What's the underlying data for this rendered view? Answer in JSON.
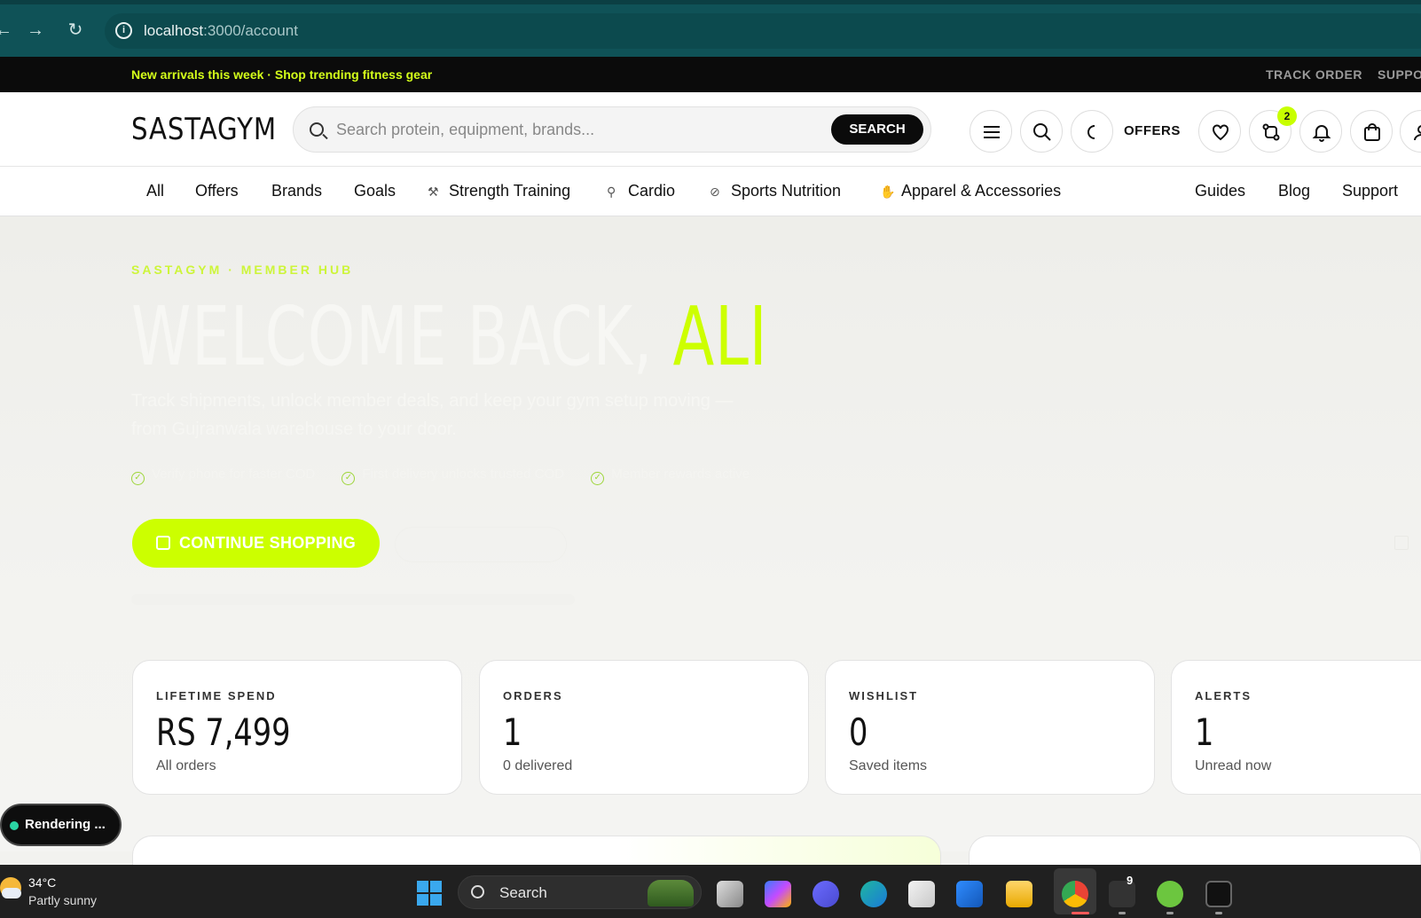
{
  "browser": {
    "url_host": "localhost",
    "url_path": ":3000/account"
  },
  "announcement": {
    "promo": "New arrivals this week · Shop trending fitness gear",
    "track_order": "TRACK ORDER",
    "support": "SUPPO"
  },
  "header": {
    "logo": "SASTAGYM",
    "search_placeholder": "Search protein, equipment, brands...",
    "search_button": "SEARCH",
    "offers": "OFFERS",
    "compare_badge": "2"
  },
  "categories": [
    {
      "label": "All"
    },
    {
      "label": "Offers"
    },
    {
      "label": "Brands"
    },
    {
      "label": "Goals"
    },
    {
      "label": "Strength Training"
    },
    {
      "label": "Cardio"
    },
    {
      "label": "Sports Nutrition"
    },
    {
      "label": "Apparel & Accessories"
    },
    {
      "label": "Guides"
    },
    {
      "label": "Blog"
    },
    {
      "label": "Support"
    }
  ],
  "hero": {
    "eyebrow": "SASTAGYM · MEMBER HUB",
    "welcome": "WELCOME BACK,",
    "name": "ALI",
    "subtitle": "Track shipments, unlock member deals, and keep your gym setup moving — from Gujranwala warehouse to your door.",
    "checks": [
      "Verify phone for faster COD",
      "First delivery unlocks trusted COD",
      "Member rewards active"
    ],
    "cta": "CONTINUE SHOPPING"
  },
  "stats": [
    {
      "label": "LIFETIME SPEND",
      "value": "RS 7,499",
      "sub": "All orders"
    },
    {
      "label": "ORDERS",
      "value": "1",
      "sub": "0 delivered"
    },
    {
      "label": "WISHLIST",
      "value": "0",
      "sub": "Saved items"
    },
    {
      "label": "ALERTS",
      "value": "1",
      "sub": "Unread now"
    }
  ],
  "overlay": {
    "rendering": "Rendering ..."
  },
  "taskbar": {
    "temp": "34°C",
    "condition": "Partly sunny",
    "search": "Search",
    "notification_count": "9"
  },
  "colors": {
    "accent": "#ccff00",
    "dark": "#0b0b0b",
    "browser": "#0f5257"
  }
}
